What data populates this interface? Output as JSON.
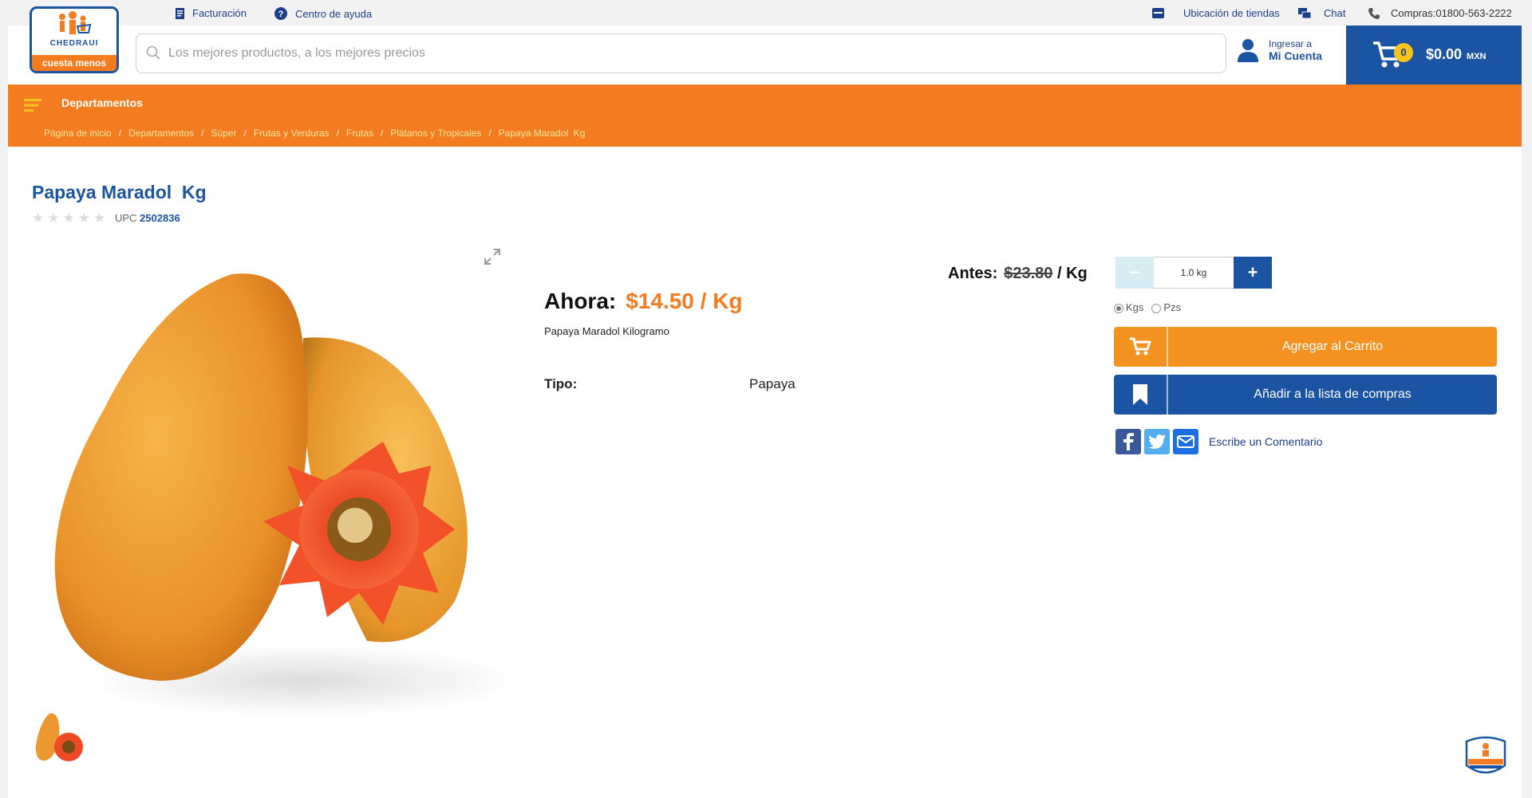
{
  "topbar": {
    "facturacion": "Facturación",
    "ayuda": "Centro de ayuda",
    "ubicacion": "Ubicación de tiendas",
    "chat": "Chat",
    "compras": "Compras:01800-563-2222"
  },
  "logo": {
    "brand": "CHEDRAUI",
    "tagline": "cuesta menos"
  },
  "search": {
    "placeholder": "Los mejores productos, a los mejores precios"
  },
  "account": {
    "line1": "Ingresar a",
    "line2": "Mi Cuenta"
  },
  "cart": {
    "count": "0",
    "total": "$0.00",
    "currency": "MXN"
  },
  "nav": {
    "departamentos": "Departamentos",
    "breadcrumbs": [
      "Página de inicio",
      "Departamentos",
      "Súper",
      "Frutas y Verduras",
      "Frutas",
      "Plátanos y Tropicales",
      "Papaya Maradol  Kg"
    ]
  },
  "product": {
    "title": "Papaya Maradol  Kg",
    "rating_stars": 0,
    "upc_label": "UPC",
    "upc": "2502836",
    "now_label": "Ahora:",
    "now_price": "$14.50 / Kg",
    "description": "Papaya Maradol Kilogramo",
    "tipo_label": "Tipo:",
    "tipo_value": "Papaya",
    "before_label": "Antes:",
    "before_price": "$23.80",
    "before_unit": "/ Kg"
  },
  "purchase": {
    "minus": "−",
    "qty": "1.0 kg",
    "plus": "+",
    "unit_kgs": "Kgs",
    "unit_pzs": "Pzs",
    "selected_unit": "Kgs",
    "add_to_cart": "Agregar al Carrito",
    "add_to_list": "Añadir a la lista de compras",
    "comment": "Escribe un Comentario"
  },
  "colors": {
    "orange": "#f47c20",
    "blue": "#1c54a4",
    "yellow": "#f7c31d"
  }
}
